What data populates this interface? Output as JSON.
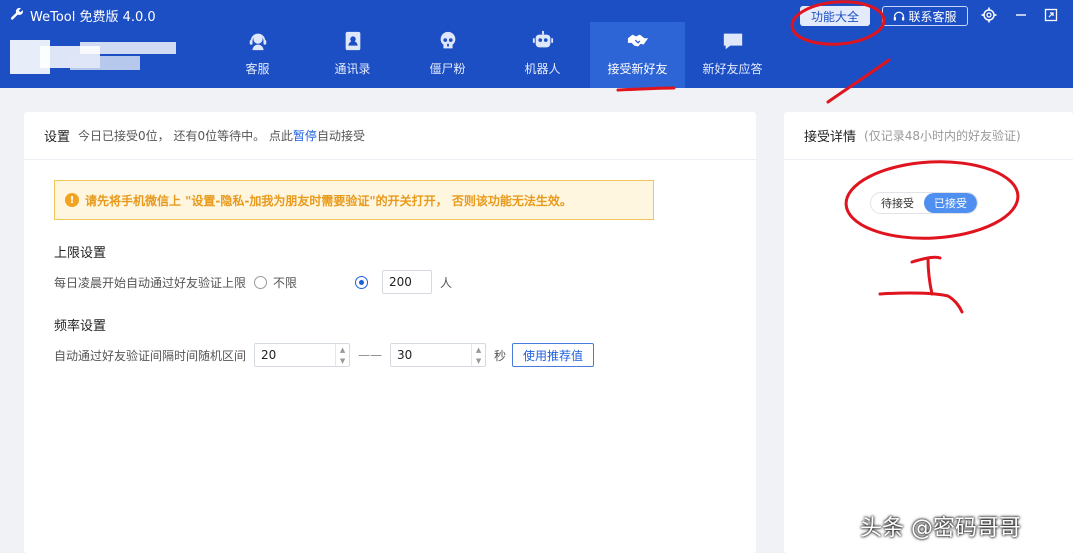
{
  "header": {
    "app_title": "WeTool 免费版 4.0.0",
    "btn_features": "功能大全",
    "btn_contact": "联系客服",
    "tabs": [
      {
        "label": "客服",
        "icon": "headset-icon"
      },
      {
        "label": "通讯录",
        "icon": "contacts-book-icon"
      },
      {
        "label": "僵尸粉",
        "icon": "skull-icon"
      },
      {
        "label": "机器人",
        "icon": "robot-icon"
      },
      {
        "label": "接受新好友",
        "icon": "handshake-icon"
      },
      {
        "label": "新好友应答",
        "icon": "chat-bubble-icon"
      }
    ],
    "active_tab": 4
  },
  "left": {
    "title": "设置",
    "status_pre": "今日已接受0位， 还有0位等待中。 点此",
    "pause_link": "暂停",
    "status_post": "自动接受",
    "warning": "请先将手机微信上 \"设置-隐私-加我为朋友时需要验证\"的开关打开， 否则该功能无法生效。",
    "limit": {
      "title": "上限设置",
      "label": "每日凌晨开始自动通过好友验证上限",
      "option_unlimited": "不限",
      "value": "200",
      "unit": "人",
      "selected": "custom"
    },
    "freq": {
      "title": "频率设置",
      "label": "自动通过好友验证间隔时间随机区间",
      "min": "20",
      "dash": "——",
      "max": "30",
      "unit": "秒",
      "recommend_button": "使用推荐值"
    }
  },
  "right": {
    "title": "接受详情",
    "subtitle": "(仅记录48小时内的好友验证)",
    "toggle_pending": "待接受",
    "toggle_accepted": "已接受",
    "selected": "accepted"
  },
  "watermark": "头条 @密码哥哥",
  "colors": {
    "header_bg": "#1d4fc4",
    "accent": "#1d5fe0",
    "annotation_red": "#e0141e"
  }
}
